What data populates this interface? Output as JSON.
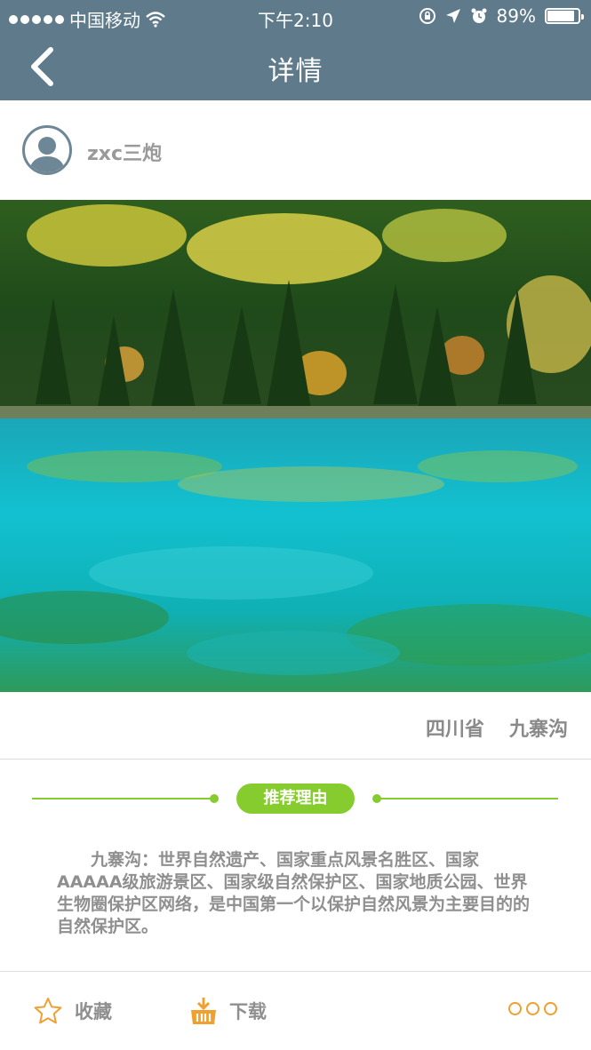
{
  "status_bar": {
    "carrier": "中国移动",
    "time": "下午2:10",
    "battery": "89%",
    "battery_level": 0.89
  },
  "nav": {
    "title": "详情"
  },
  "user": {
    "name": "zxc三炮"
  },
  "location": {
    "province": "四川省",
    "place": "九寨沟"
  },
  "recommend": {
    "tag": "推荐理由",
    "text": "九寨沟：世界自然遗产、国家重点风景名胜区、国家AAAAA级旅游景区、国家级自然保护区、国家地质公园、世界生物圈保护区网络，是中国第一个以保护自然风景为主要目的的自然保护区。"
  },
  "toolbar": {
    "favorite_label": "收藏",
    "download_label": "下载"
  },
  "colors": {
    "header": "#5f7b8b",
    "accent_green": "#86cc2e",
    "accent_orange": "#f0a030"
  },
  "icons": {
    "back": "chevron-left-icon",
    "avatar": "user-avatar-icon",
    "favorite": "star-icon",
    "download": "download-basket-icon",
    "more": "more-icon"
  }
}
